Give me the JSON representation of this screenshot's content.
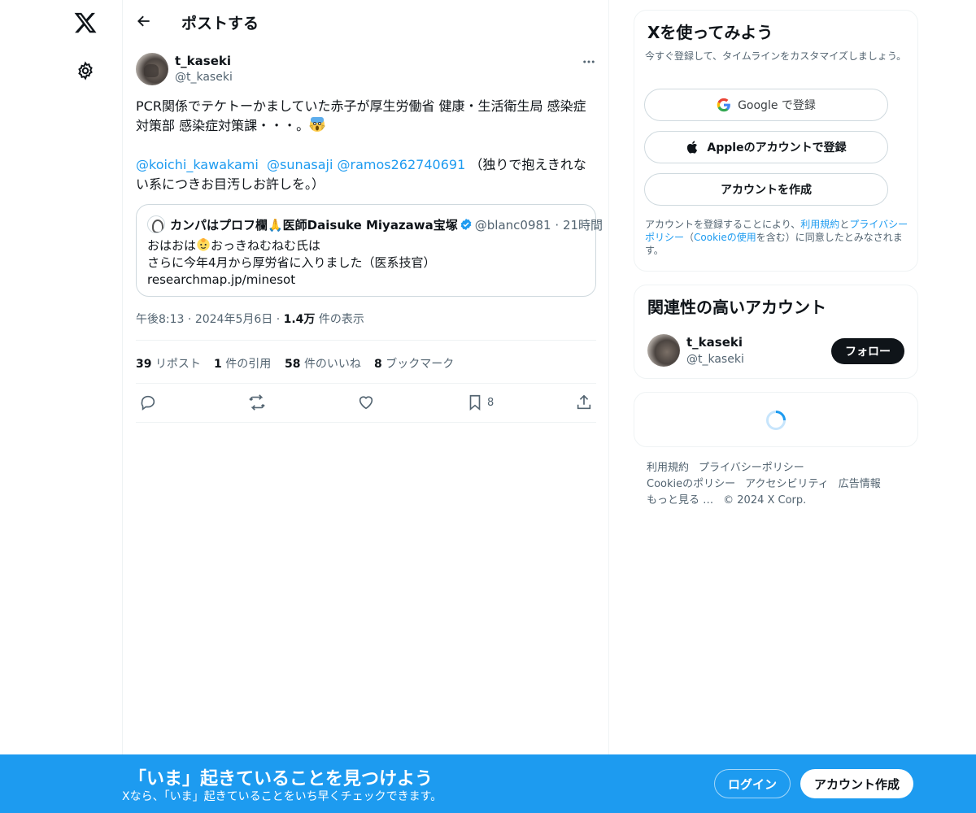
{
  "nav": {
    "logo_icon": "x-logo-icon",
    "settings_icon": "gear-icon"
  },
  "header": {
    "title": "ポストする",
    "back_icon": "arrow-left-icon"
  },
  "tweet": {
    "author_name": "t_kaseki",
    "author_handle": "@t_kaseki",
    "text_line1": "PCR関係でテケトーかましていた赤子が厚生労働省 健康・生活衛生局 感染症対策部 感染症対策課・・・。",
    "mention1": "@koichi_kawakami",
    "mention2": "@sunasaji",
    "mention3": "@ramos262740691",
    "text_tail": "（独りで抱えきれない系につきお目汚しお許しを。）",
    "timestamp_time": "午後8:13",
    "timestamp_date": "2024年5月6日",
    "views_count": "1.4万",
    "views_label": "件の表示",
    "sep": "·"
  },
  "quote": {
    "name": "カンパはプロフ欄🙏医師Daisuke Miyazawa宝塚",
    "handle": "@blanc0981",
    "time": "21時間",
    "sep": "·",
    "line1a": "おはおは",
    "line1b": "おっきねむねむ氏は",
    "line2": "さらに今年4月から厚労省に入りました（医系技官）",
    "line3": "researchmap.jp/minesot"
  },
  "stats": {
    "reposts_count": "39",
    "reposts_label": "リポスト",
    "quotes_count": "1",
    "quotes_label": "件の引用",
    "likes_count": "58",
    "likes_label": "件のいいね",
    "bookmarks_count": "8",
    "bookmarks_label": "ブックマーク"
  },
  "actions": {
    "bookmark_count": "8"
  },
  "signup_panel": {
    "title": "Xを使ってみよう",
    "subtitle": "今すぐ登録して、タイムラインをカスタマイズしましょう。",
    "google_label": "Google で登録",
    "apple_label": "Appleのアカウントで登録",
    "create_label": "アカウントを作成",
    "legal_a": "アカウントを登録することにより、",
    "legal_terms": "利用規約",
    "legal_b": "と",
    "legal_privacy": "プライバシーポリシー",
    "legal_c": "（",
    "legal_cookie": "Cookieの使用",
    "legal_d": "を含む）に同意したとみなされます。"
  },
  "related": {
    "title": "関連性の高いアカウント",
    "name": "t_kaseki",
    "handle": "@t_kaseki",
    "follow_label": "フォロー"
  },
  "footer": {
    "terms": "利用規約",
    "privacy": "プライバシーポリシー",
    "cookie": "Cookieのポリシー",
    "accessibility": "アクセシビリティ",
    "ads": "広告情報",
    "more": "もっと見る …",
    "copyright": "© 2024 X Corp."
  },
  "banner": {
    "title": "「いま」起きていることを見つけよう",
    "subtitle": "Xなら、「いま」起きていることをいち早くチェックできます。",
    "login_label": "ログイン",
    "signup_label": "アカウント作成"
  },
  "colors": {
    "accent": "#1d9bf0",
    "text": "#0f1419",
    "muted": "#536471",
    "border": "#eff3f4"
  }
}
